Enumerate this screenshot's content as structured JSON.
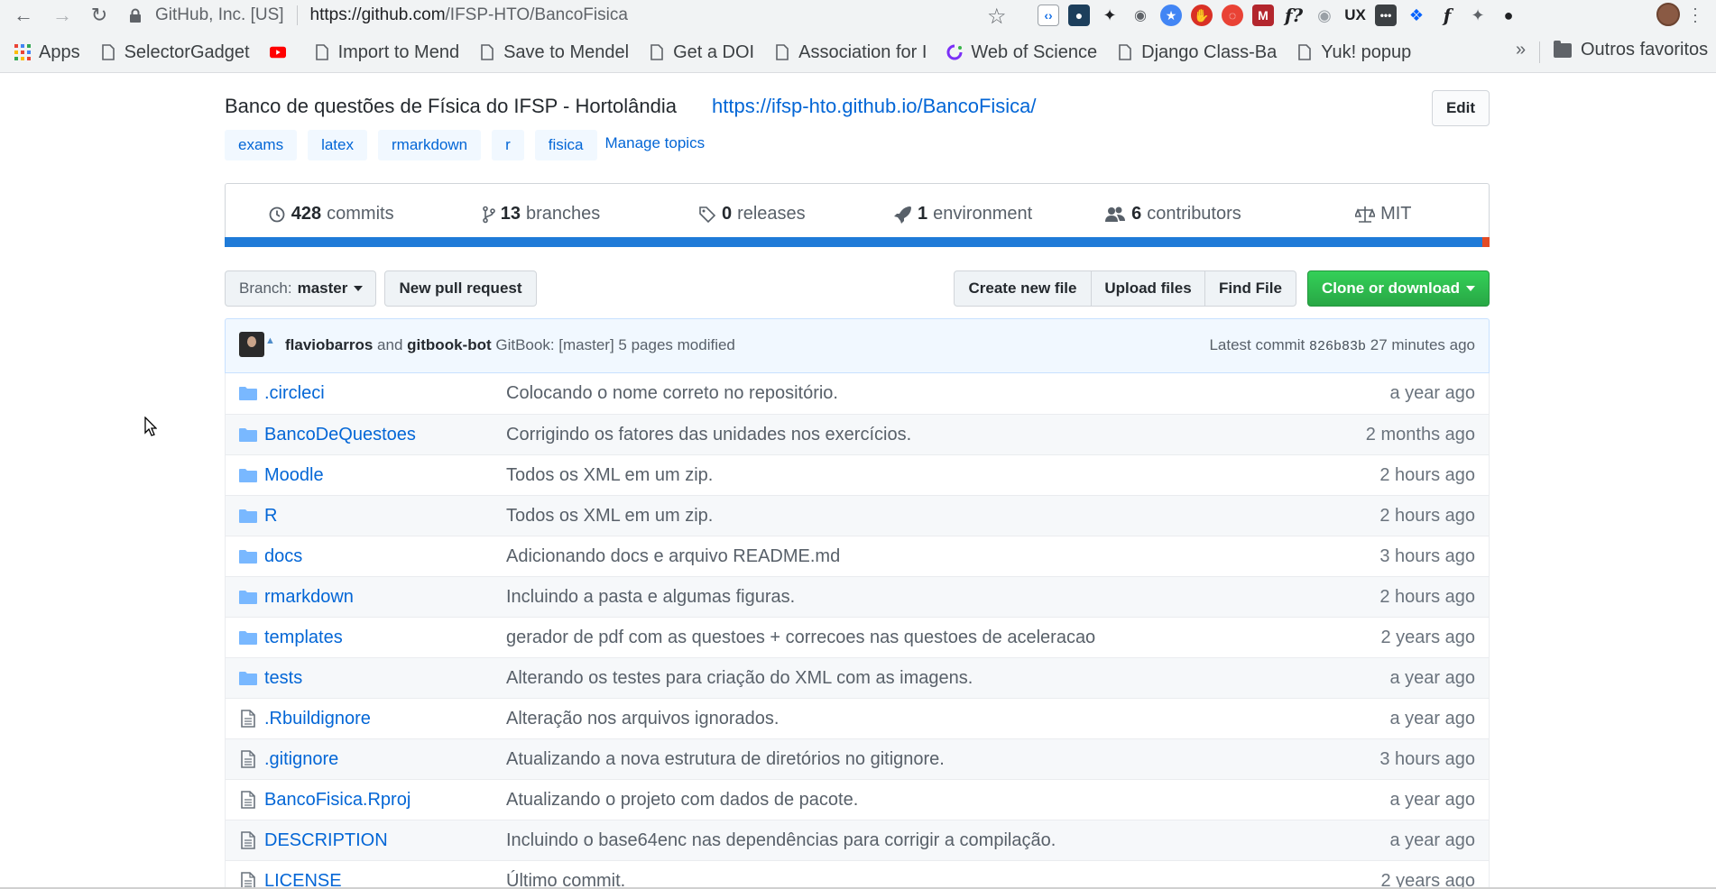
{
  "browser": {
    "site_label": "GitHub, Inc. [US]",
    "url_host": "https://github.com",
    "url_path": "/IFSP-HTO/BancoFisica",
    "bookmarks": [
      {
        "label": "Apps",
        "icon": "apps-grid-icon"
      },
      {
        "label": "SelectorGadget",
        "icon": "page-icon"
      },
      {
        "label": "",
        "icon": "youtube-icon"
      },
      {
        "label": "Import to Mend",
        "icon": "page-icon"
      },
      {
        "label": "Save to Mendel",
        "icon": "page-icon"
      },
      {
        "label": "Get a DOI",
        "icon": "page-icon"
      },
      {
        "label": "Association for I",
        "icon": "page-icon"
      },
      {
        "label": "Web of Science",
        "icon": "clarivate-icon"
      },
      {
        "label": "Django Class-Ba",
        "icon": "page-icon"
      },
      {
        "label": "Yuk! popup",
        "icon": "page-icon"
      }
    ],
    "bookmarks_more": "»",
    "other_bookmarks": "Outros favoritos"
  },
  "repo": {
    "description": "Banco de questões de Física do IFSP - Hortolândia",
    "website": "https://ifsp-hto.github.io/BancoFisica/",
    "edit_label": "Edit",
    "topics": [
      "exams",
      "latex",
      "rmarkdown",
      "r",
      "fisica"
    ],
    "manage_topics": "Manage topics",
    "stats": {
      "commits_count": "428",
      "commits_label": "commits",
      "branches_count": "13",
      "branches_label": "branches",
      "releases_count": "0",
      "releases_label": "releases",
      "environment_count": "1",
      "environment_label": "environment",
      "contributors_count": "6",
      "contributors_label": "contributors",
      "license": "MIT"
    },
    "language_colors": {
      "primary": "#1f7bd8",
      "secondary": "#e34c26"
    },
    "language_fractions": {
      "primary": 0.994,
      "secondary": 0.006
    }
  },
  "toolbar": {
    "branch_prefix": "Branch:",
    "branch_name": "master",
    "new_pr": "New pull request",
    "create_file": "Create new file",
    "upload_files": "Upload files",
    "find_file": "Find File",
    "clone": "Clone or download"
  },
  "latest_commit": {
    "author": "flaviobarros",
    "and": "and",
    "coauthor": "gitbook-bot",
    "message": "GitBook: [master] 5 pages modified",
    "label": "Latest commit",
    "sha": "826b83b",
    "age": "27 minutes ago"
  },
  "files": [
    {
      "name": ".circleci",
      "type": "dir",
      "message": "Colocando o nome correto no repositório.",
      "age": "a year ago"
    },
    {
      "name": "BancoDeQuestoes",
      "type": "dir",
      "message": "Corrigindo os fatores das unidades nos exercícios.",
      "age": "2 months ago"
    },
    {
      "name": "Moodle",
      "type": "dir",
      "message": "Todos os XML em um zip.",
      "age": "2 hours ago"
    },
    {
      "name": "R",
      "type": "dir",
      "message": "Todos os XML em um zip.",
      "age": "2 hours ago"
    },
    {
      "name": "docs",
      "type": "dir",
      "message": "Adicionando docs e arquivo README.md",
      "age": "3 hours ago"
    },
    {
      "name": "rmarkdown",
      "type": "dir",
      "message": "Incluindo a pasta e algumas figuras.",
      "age": "2 hours ago"
    },
    {
      "name": "templates",
      "type": "dir",
      "message": "gerador de pdf com as questoes + correcoes nas questoes de aceleracao",
      "age": "2 years ago"
    },
    {
      "name": "tests",
      "type": "dir",
      "message": "Alterando os testes para criação do XML com as imagens.",
      "age": "a year ago"
    },
    {
      "name": ".Rbuildignore",
      "type": "file",
      "message": "Alteração nos arquivos ignorados.",
      "age": "a year ago"
    },
    {
      "name": ".gitignore",
      "type": "file",
      "message": "Atualizando a nova estrutura de diretórios no gitignore.",
      "age": "3 hours ago"
    },
    {
      "name": "BancoFisica.Rproj",
      "type": "file",
      "message": "Atualizando o projeto com dados de pacote.",
      "age": "a year ago"
    },
    {
      "name": "DESCRIPTION",
      "type": "file",
      "message": "Incluindo o base64enc nas dependências para corrigir a compilação.",
      "age": "a year ago"
    },
    {
      "name": "LICENSE",
      "type": "file",
      "message": "Último commit.",
      "age": "2 years ago"
    }
  ]
}
